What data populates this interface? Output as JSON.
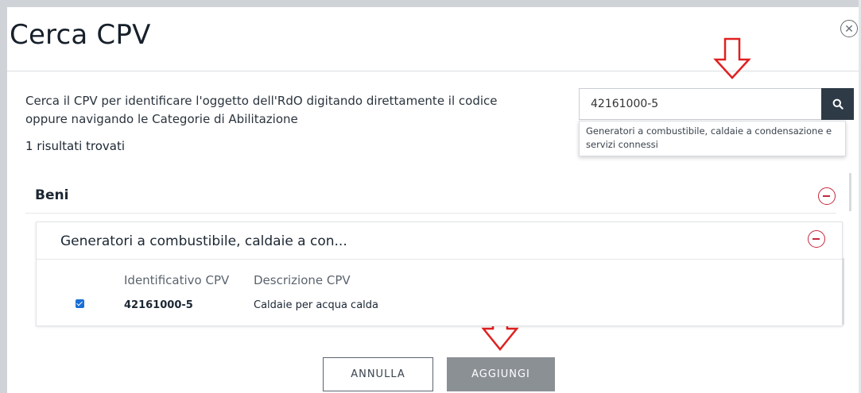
{
  "dialog": {
    "title": "Cerca CPV",
    "close_icon": "close-circle-icon"
  },
  "intro": {
    "description": "Cerca il CPV per identificare l'oggetto dell'RdO digitando direttamente il codice oppure navigando le Categorie di Abilitazione",
    "results_count": "1 risultati trovati"
  },
  "search": {
    "value": "42161000-5",
    "button_icon": "search-icon",
    "suggestion": "Generatori a combustibile, caldaie a condensazione e servizi connessi"
  },
  "tree": {
    "group_label": "Beni",
    "group_toggle_icon": "minus-circle-icon",
    "category_label": "Generatori a combustibile, caldaie a con...",
    "category_toggle_icon": "minus-circle-icon",
    "columns": [
      "Identificativo CPV",
      "Descrizione CPV"
    ],
    "rows": [
      {
        "checked": true,
        "code": "42161000-5",
        "description": "Caldaie per acqua calda"
      }
    ]
  },
  "footer": {
    "cancel_label": "ANNULLA",
    "add_label": "AGGIUNGI"
  },
  "annotations": {
    "arrow_icon": "red-down-arrow-icon",
    "color": "#e02020"
  },
  "colors": {
    "search_button_bg": "#2e3a46",
    "toggle_accent": "#c5283d",
    "checkbox": "#1a6fd6",
    "add_button_bg": "#8b9095"
  }
}
